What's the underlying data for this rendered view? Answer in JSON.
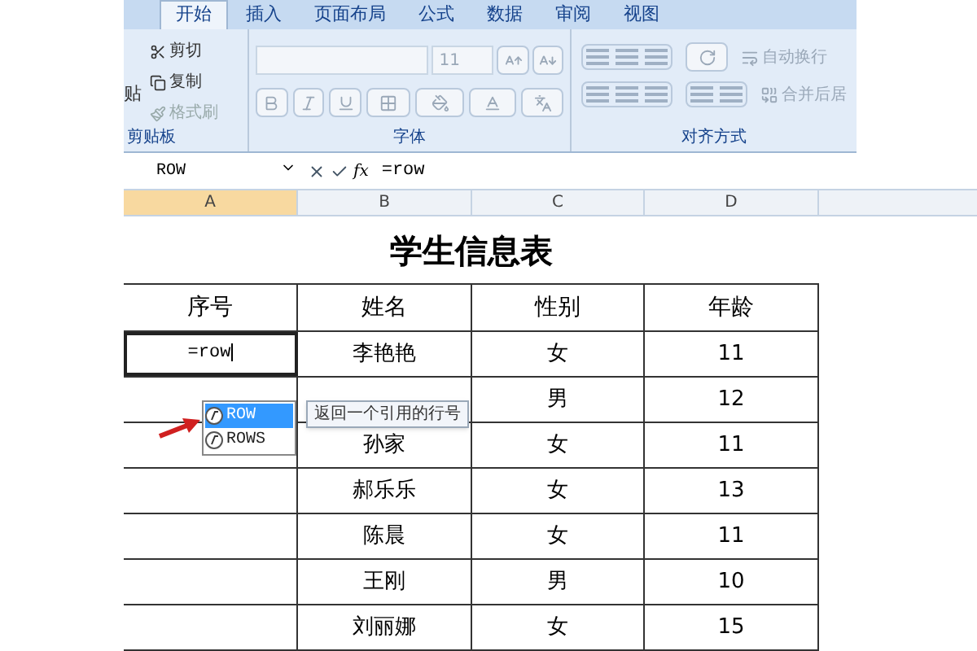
{
  "ribbon_tabs": [
    {
      "label": "开始",
      "selected": true
    },
    {
      "label": "插入",
      "selected": false
    },
    {
      "label": "页面布局",
      "selected": false
    },
    {
      "label": "公式",
      "selected": false
    },
    {
      "label": "数据",
      "selected": false
    },
    {
      "label": "审阅",
      "selected": false
    },
    {
      "label": "视图",
      "selected": false
    }
  ],
  "clipboard": {
    "paste": "贴",
    "cut": "剪切",
    "copy": "复制",
    "format_painter": "格式刷",
    "group_label": "剪贴板"
  },
  "font": {
    "size": "11",
    "group_label": "字体"
  },
  "alignment": {
    "wrap_text": "自动换行",
    "merge_center": "合并后居",
    "group_label": "对齐方式"
  },
  "formula_bar": {
    "name_box": "ROW",
    "function_label": "fx",
    "formula": "=row"
  },
  "columns": [
    "A",
    "B",
    "C",
    "D"
  ],
  "sheet": {
    "title": "学生信息表",
    "headers": [
      "序号",
      "姓名",
      "性别",
      "年龄"
    ],
    "editing_cell": "=row",
    "rows": [
      [
        "李艳艳",
        "女",
        "11"
      ],
      [
        "",
        "男",
        "12"
      ],
      [
        "孙家",
        "女",
        "11"
      ],
      [
        "郝乐乐",
        "女",
        "13"
      ],
      [
        "陈晨",
        "女",
        "11"
      ],
      [
        "王刚",
        "男",
        "10"
      ],
      [
        "刘丽娜",
        "女",
        "15"
      ]
    ]
  },
  "autocomplete": {
    "items": [
      {
        "label": "ROW",
        "selected": true
      },
      {
        "label": "ROWS",
        "selected": false
      }
    ],
    "tooltip": "返回一个引用的行号"
  }
}
